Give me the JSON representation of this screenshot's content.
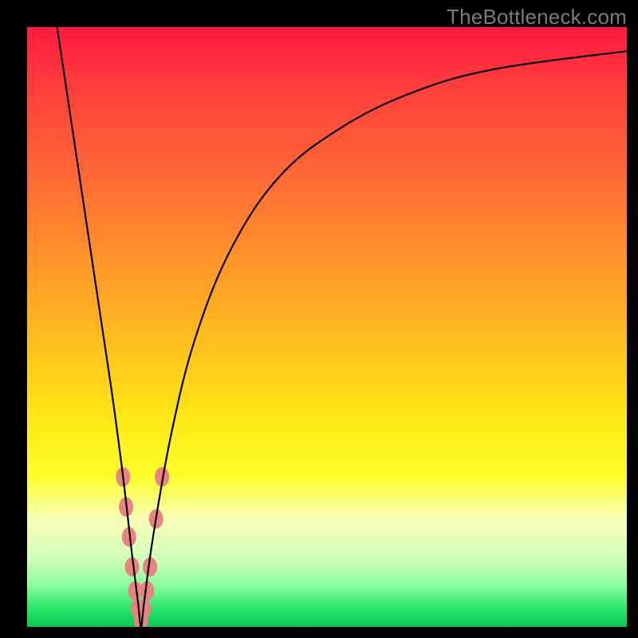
{
  "watermark": "TheBottleneck.com",
  "chart_data": {
    "type": "line",
    "title": "",
    "xlabel": "",
    "ylabel": "",
    "xlim": [
      0,
      100
    ],
    "ylim": [
      0,
      100
    ],
    "axis_visible": false,
    "background_gradient": {
      "direction": "vertical",
      "stops": [
        {
          "pos": 0.0,
          "color": "#ff1a41"
        },
        {
          "pos": 0.1,
          "color": "#ff3e3d"
        },
        {
          "pos": 0.25,
          "color": "#ff6a35"
        },
        {
          "pos": 0.45,
          "color": "#ffa724"
        },
        {
          "pos": 0.65,
          "color": "#ffe714"
        },
        {
          "pos": 0.75,
          "color": "#fdff2c"
        },
        {
          "pos": 0.82,
          "color": "#f6ffb4"
        },
        {
          "pos": 0.88,
          "color": "#d7ffba"
        },
        {
          "pos": 0.93,
          "color": "#8cff9e"
        },
        {
          "pos": 0.97,
          "color": "#28e66a"
        },
        {
          "pos": 1.0,
          "color": "#06c94f"
        }
      ]
    },
    "series": [
      {
        "name": "bottleneck-curve",
        "color": "#000000",
        "stroke_width": 2,
        "points": [
          {
            "x": 5.0,
            "y": 100.0
          },
          {
            "x": 8.0,
            "y": 80.0
          },
          {
            "x": 11.0,
            "y": 60.0
          },
          {
            "x": 14.0,
            "y": 40.0
          },
          {
            "x": 16.0,
            "y": 25.0
          },
          {
            "x": 17.5,
            "y": 12.0
          },
          {
            "x": 18.5,
            "y": 4.0
          },
          {
            "x": 19.0,
            "y": 0.0
          },
          {
            "x": 19.5,
            "y": 4.0
          },
          {
            "x": 21.0,
            "y": 15.0
          },
          {
            "x": 24.0,
            "y": 32.0
          },
          {
            "x": 28.0,
            "y": 48.0
          },
          {
            "x": 34.0,
            "y": 63.0
          },
          {
            "x": 42.0,
            "y": 75.0
          },
          {
            "x": 52.0,
            "y": 83.0
          },
          {
            "x": 64.0,
            "y": 89.0
          },
          {
            "x": 78.0,
            "y": 93.0
          },
          {
            "x": 100.0,
            "y": 96.0
          }
        ]
      }
    ],
    "markers": {
      "name": "highlight-points",
      "color": "#e98283",
      "radius_px": 9,
      "points": [
        {
          "x": 16.0,
          "y": 25.0
        },
        {
          "x": 16.5,
          "y": 20.0
        },
        {
          "x": 17.0,
          "y": 15.0
        },
        {
          "x": 17.5,
          "y": 10.0
        },
        {
          "x": 18.0,
          "y": 6.0
        },
        {
          "x": 18.5,
          "y": 3.0
        },
        {
          "x": 19.0,
          "y": 1.0
        },
        {
          "x": 19.5,
          "y": 3.0
        },
        {
          "x": 20.0,
          "y": 6.0
        },
        {
          "x": 20.5,
          "y": 10.0
        },
        {
          "x": 21.5,
          "y": 18.0
        },
        {
          "x": 22.5,
          "y": 25.0
        }
      ]
    }
  }
}
